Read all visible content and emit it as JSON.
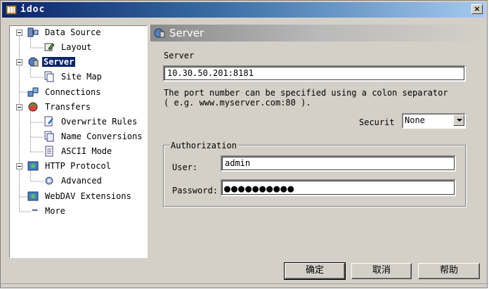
{
  "window": {
    "title": "idoc",
    "close_label": "×"
  },
  "tree": {
    "items": [
      {
        "label": "Data Source",
        "icon": "data-source-icon",
        "level": 0,
        "expanded": true
      },
      {
        "label": "Layout",
        "icon": "layout-icon",
        "level": 1
      },
      {
        "label": "Server",
        "icon": "server-icon",
        "level": 0,
        "expanded": true,
        "selected": true
      },
      {
        "label": "Site Map",
        "icon": "site-map-icon",
        "level": 1
      },
      {
        "label": "Connections",
        "icon": "connections-icon",
        "level": 0
      },
      {
        "label": "Transfers",
        "icon": "transfers-icon",
        "level": 0,
        "expanded": true
      },
      {
        "label": "Overwrite Rules",
        "icon": "overwrite-rules-icon",
        "level": 1
      },
      {
        "label": "Name Conversions",
        "icon": "name-conversions-icon",
        "level": 1
      },
      {
        "label": "ASCII Mode",
        "icon": "ascii-mode-icon",
        "level": 1
      },
      {
        "label": "HTTP Protocol",
        "icon": "http-protocol-icon",
        "level": 0,
        "expanded": true
      },
      {
        "label": "Advanced",
        "icon": "advanced-icon",
        "level": 1
      },
      {
        "label": "WebDAV Extensions",
        "icon": "webdav-icon",
        "level": 0
      },
      {
        "label": "More",
        "icon": "more-icon",
        "level": 0
      }
    ]
  },
  "panel": {
    "title": "Server",
    "server_label": "Server",
    "server_value": "10.30.50.201:8181",
    "hint_line1": "The port number can be specified using a colon separator",
    "hint_line2": "( e.g. www.myserver.com:80 ).",
    "security_label": "Securit",
    "security_value": "None",
    "auth_group": "Authorization",
    "user_label": "User:",
    "user_value": "admin",
    "password_label": "Password:",
    "password_mask": "●●●●●●●●●●"
  },
  "buttons": {
    "ok": "确定",
    "cancel": "取消",
    "help": "帮助"
  },
  "colors": {
    "titlebar": "#0a246a",
    "selection": "#0a246a",
    "face": "#d4d0c8"
  }
}
